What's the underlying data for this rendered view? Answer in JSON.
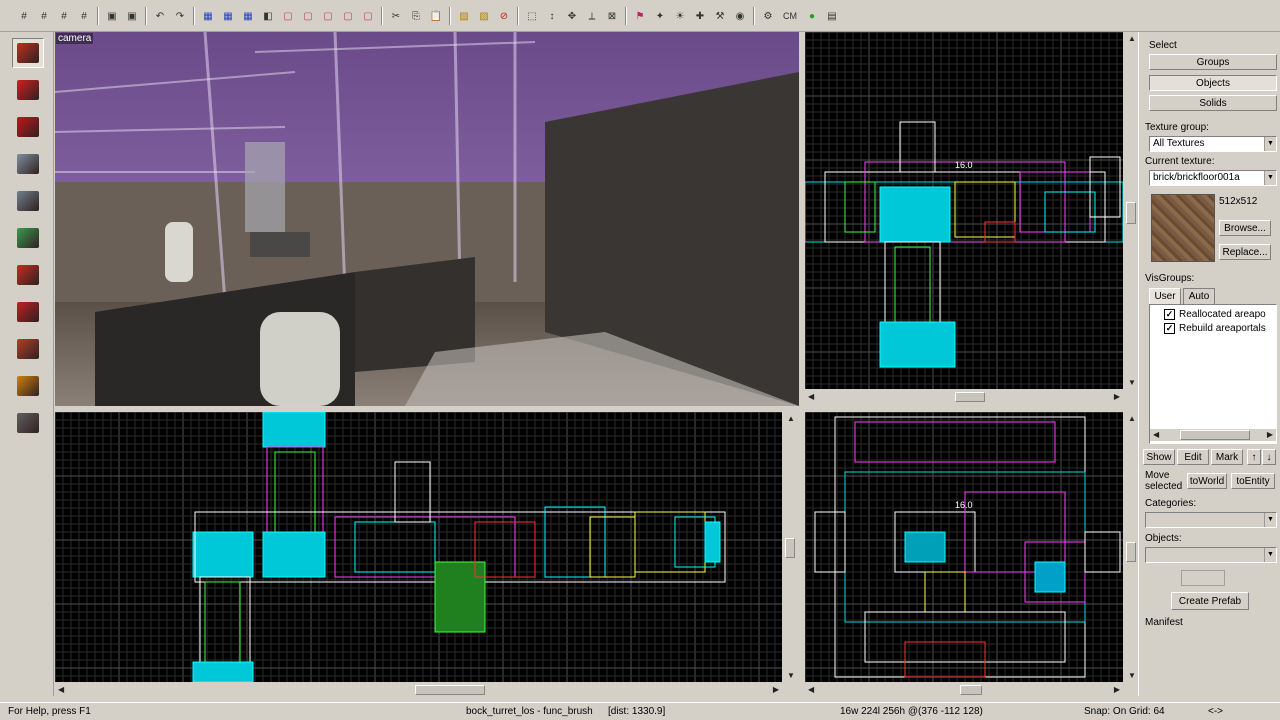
{
  "toolbar": {
    "icons": [
      "grid-icon",
      "grid-icon",
      "grid-icon",
      "grid-icon",
      "carve-icon",
      "carve-icon",
      "undo-icon",
      "redo-icon",
      "group-icon",
      "group-icon",
      "group-icon",
      "ungroup-icon",
      "hide-icon",
      "hide-icon",
      "hide-icon",
      "hide-icon",
      "hide-icon",
      "cut-icon",
      "copy-icon",
      "paste-icon",
      "texture-lock-icon",
      "texture-lock-icon",
      "no-entry-icon",
      "select-icon",
      "arrow-icon",
      "vertex-icon",
      "clip-icon",
      "cordon-icon",
      "flag-icon",
      "sprite-icon",
      "light-icon",
      "clip-tool-icon",
      "hammer-icon",
      "camera-icon",
      "settings-icon",
      "cm-label",
      "run-icon",
      "manifest-icon"
    ],
    "cm_label": "CM"
  },
  "tools": [
    {
      "name": "selection-tool-icon",
      "color": "#c03020"
    },
    {
      "name": "magnify-tool-icon",
      "color": "#d02020"
    },
    {
      "name": "camera-tool-icon",
      "color": "#c01818"
    },
    {
      "name": "entity-tool-icon",
      "color": "#8090a0"
    },
    {
      "name": "block-tool-icon",
      "color": "#708090"
    },
    {
      "name": "texture-tool-icon",
      "color": "#3a9a50"
    },
    {
      "name": "apply-texture-icon",
      "color": "#c03020"
    },
    {
      "name": "decal-tool-icon",
      "color": "#c02020"
    },
    {
      "name": "overlay-tool-icon",
      "color": "#b04028"
    },
    {
      "name": "clipping-tool-icon",
      "color": "#d08010"
    },
    {
      "name": "vertex-tool-icon",
      "color": "#606060"
    }
  ],
  "camera_view": {
    "label": "camera"
  },
  "panel": {
    "select_label": "Select",
    "groups_button": "Groups",
    "objects_button": "Objects",
    "solids_button": "Solids",
    "texture_group_label": "Texture group:",
    "texture_group_value": "All Textures",
    "current_texture_label": "Current texture:",
    "current_texture_value": "brick/brickfloor001a",
    "texture_size": "512x512",
    "browse_button": "Browse...",
    "replace_button": "Replace...",
    "visgroups_label": "VisGroups:",
    "tab_user": "User",
    "tab_auto": "Auto",
    "visgroup_items": [
      "Reallocated areapo",
      "Rebuild areaportals"
    ],
    "show_button": "Show",
    "edit_button": "Edit",
    "mark_button": "Mark",
    "move_selected_label_1": "Move",
    "move_selected_label_2": "selected",
    "to_world_button": "toWorld",
    "to_entity_button": "toEntity",
    "categories_label": "Categories:",
    "objects_label": "Objects:",
    "create_prefab_button": "Create Prefab",
    "manifest_label": "Manifest"
  },
  "views": {
    "top_right_label": "16.0",
    "bottom_right_label": "16.0"
  },
  "status": {
    "help": "For Help, press F1",
    "selection": "bock_turret_los - func_brush",
    "dist": "[dist: 1330.9]",
    "size_pos": "16w 224l 256h @(376 -112 128)",
    "snap": "Snap: On Grid: 64",
    "arrow": "<->"
  }
}
